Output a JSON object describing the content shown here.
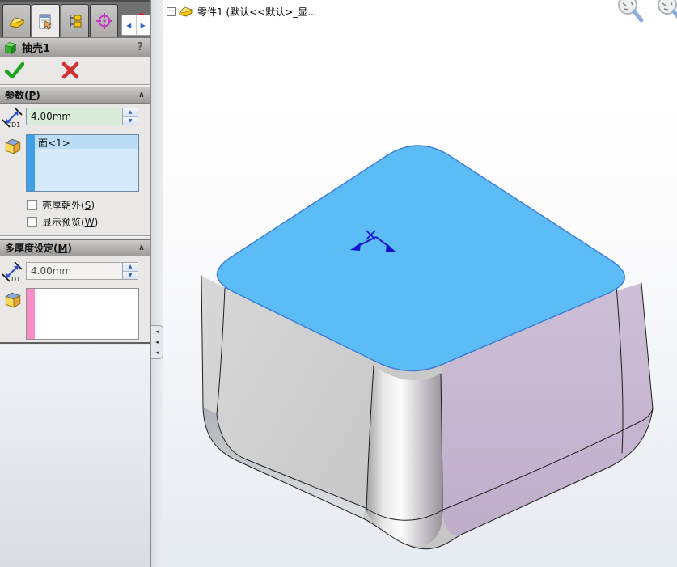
{
  "colors": {
    "top_face": "#5CBCF6",
    "edge_blue": "#3E7ED8",
    "arrow_blue": "#1414CC",
    "check_green": "#1FA31F",
    "cancel_red": "#D03030",
    "stripe_blue": "#3FA0E8",
    "stripe_pink": "#F98CC9",
    "input_green_bg": "#D9EBD9",
    "dimxpert_magenta": "#C238C2"
  },
  "icons": {
    "help": "?",
    "expand_plus": "+",
    "spinner_up": "▲",
    "spinner_down": "▼",
    "scroll_left": "◀",
    "scroll_right": "▶",
    "splitter_grip": "◂",
    "collapse_chevron": "∧"
  },
  "panel": {
    "title": "抽壳1",
    "params": {
      "title_pre": "参数(",
      "title_key": "P",
      "title_post": ")",
      "d1_label": "D1",
      "thickness": "4.00mm",
      "selected_faces": [
        "面<1>"
      ],
      "checkboxes": [
        {
          "pre": "壳厚朝外(",
          "key": "S",
          "post": ")",
          "checked": false
        },
        {
          "pre": "显示预览(",
          "key": "W",
          "post": ")",
          "checked": false
        }
      ]
    },
    "multi": {
      "title_pre": "多厚度设定(",
      "title_key": "M",
      "title_post": ")",
      "d1_label": "D1",
      "thickness": "4.00mm",
      "selected_faces": []
    }
  },
  "viewport": {
    "feature_tree_node": "零件1 (默认<<默认>_显..."
  }
}
